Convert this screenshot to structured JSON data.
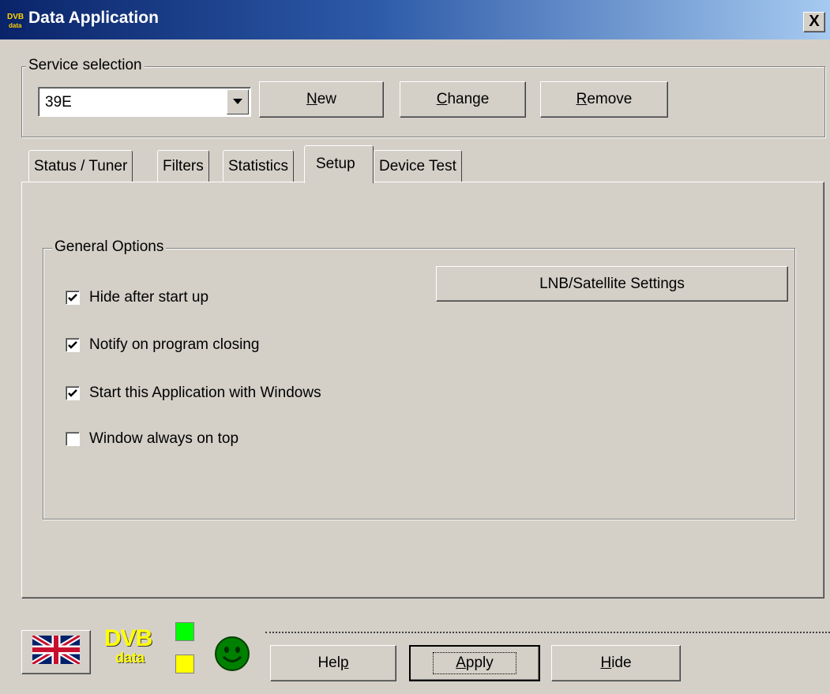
{
  "window": {
    "title": "Data Application",
    "close_label": "X"
  },
  "service_selection": {
    "legend": "Service selection",
    "selected_value": "39E",
    "buttons": {
      "new": {
        "before": "",
        "mnemonic": "N",
        "after": "ew"
      },
      "change": {
        "before": "",
        "mnemonic": "C",
        "after": "hange"
      },
      "remove": {
        "before": "",
        "mnemonic": "R",
        "after": "emove"
      }
    }
  },
  "tabs": [
    {
      "label": "Status / Tuner",
      "active": false
    },
    {
      "label": "Filters",
      "active": false
    },
    {
      "label": "Statistics",
      "active": false
    },
    {
      "label": "Setup",
      "active": true
    },
    {
      "label": "Device Test",
      "active": false
    }
  ],
  "general_options": {
    "legend": "General Options",
    "lnb_button": "LNB/Satellite Settings",
    "options": [
      {
        "label": "Hide after start up",
        "checked": true
      },
      {
        "label": "Notify on program closing",
        "checked": true
      },
      {
        "label": "Start this Application with Windows",
        "checked": true
      },
      {
        "label": "Window always on top",
        "checked": false
      }
    ]
  },
  "footer": {
    "logo_line1": "DVB",
    "logo_line2": "data",
    "icon_language": "uk-flag-icon",
    "led_top_color": "#00ff00",
    "led_bottom_color": "#ffff00",
    "status_icon": "smiley-icon",
    "status_color": "#008000",
    "buttons": {
      "help": {
        "before": "Hel",
        "mnemonic": "p",
        "after": ""
      },
      "apply": {
        "before": "",
        "mnemonic": "A",
        "after": "pply"
      },
      "hide": {
        "before": "",
        "mnemonic": "H",
        "after": "ide"
      }
    }
  }
}
